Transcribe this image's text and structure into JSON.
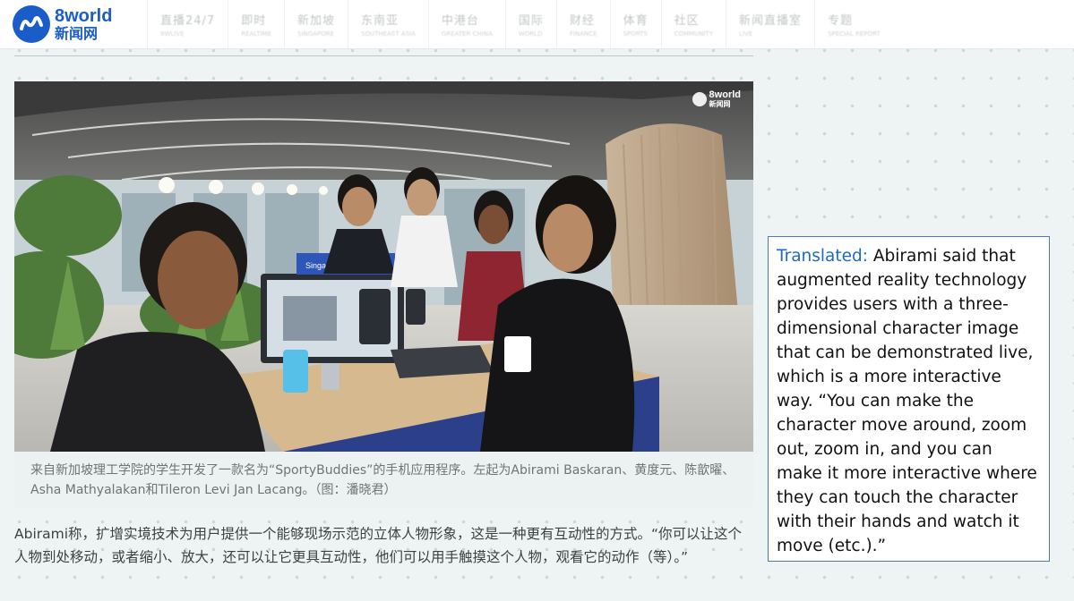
{
  "logo": {
    "line1": "8world",
    "line2": "新闻网"
  },
  "nav": [
    {
      "zh": "直播24/7",
      "en": "8WLIVE"
    },
    {
      "zh": "即时",
      "en": "REALTIME"
    },
    {
      "zh": "新加坡",
      "en": "SINGAPORE"
    },
    {
      "zh": "东南亚",
      "en": "SOUTHEAST ASIA"
    },
    {
      "zh": "中港台",
      "en": "GREATER CHINA"
    },
    {
      "zh": "国际",
      "en": "WORLD"
    },
    {
      "zh": "财经",
      "en": "FINANCE"
    },
    {
      "zh": "体育",
      "en": "SPORTS"
    },
    {
      "zh": "社区",
      "en": "COMMUNITY"
    },
    {
      "zh": "新闻直播室",
      "en": "LIVE"
    },
    {
      "zh": "专题",
      "en": "SPECIAL REPORT"
    }
  ],
  "photo": {
    "watermark_line1": "8world",
    "watermark_line2": "新闻网",
    "banner_text": "Singapore Polytechnic"
  },
  "caption": "来自新加坡理工学院的学生开发了一款名为“SportyBuddies”的手机应用程序。左起为Abirami Baskaran、黄度元、陈歆曜、Asha Mathyalakan和Tileron Levi Jan Lacang。（图：潘晓君）",
  "body_text": "Abirami称，扩增实境技术为用户提供一个能够现场示范的立体人物形象，这是一种更有互动性的方式。“你可以让这个人物到处移动，或者缩小、放大，还可以让它更具互动性，他们可以用手触摸这个人物，观看它的动作（等）。”",
  "translation": {
    "label": "Translated:",
    "text": "Abirami said that augmented reality technology provides users with a three-dimensional character image that can be demonstrated live, which is a more interactive way. “You can make the character move around, zoom out, zoom in, and you can make it more interactive where they can touch the character with their hands and watch it move (etc.).”"
  },
  "colors": {
    "brand": "#1a5dc8",
    "translation_label": "#1f69c7",
    "translation_border": "#4a78c2"
  }
}
